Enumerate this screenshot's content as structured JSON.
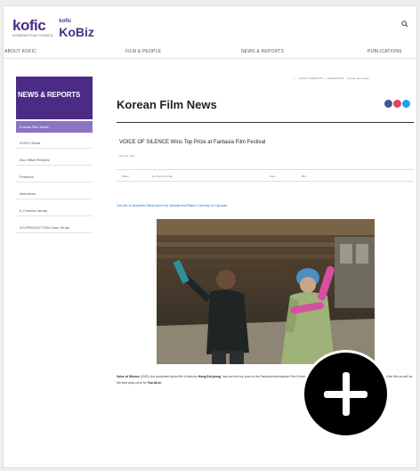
{
  "header": {
    "logo_primary": "kofic",
    "logo_primary_sub": "KOREAN FILM COUNCIL",
    "logo_secondary_small": "kofic",
    "logo_secondary": "KoBiz",
    "search_icon": "search-icon"
  },
  "nav": {
    "items": [
      "ABOUT KOFIC",
      "FILM & PEOPLE",
      "NEWS & REPORTS",
      "PUBLICATIONS"
    ]
  },
  "sidebar": {
    "heading": "NEWS & REPORTS",
    "items": [
      {
        "label": "Korean Film News",
        "active": true
      },
      {
        "label": "KOFIC News",
        "active": false
      },
      {
        "label": "Box Office Reports",
        "active": false
      },
      {
        "label": "Features",
        "active": false
      },
      {
        "label": "Interviews",
        "active": false
      },
      {
        "label": "K-Cinema Library",
        "active": false
      },
      {
        "label": "KO-PRODUCTION Case Study",
        "active": false
      }
    ]
  },
  "breadcrumb": {
    "items": [
      "⌂",
      "NEWS & REPORTS",
      "NEWSROOM",
      "Korean Film News"
    ]
  },
  "main": {
    "title": "Korean Film News",
    "share_colors": [
      "#3b5998",
      "#e4405f",
      "#1da1f2"
    ]
  },
  "article": {
    "title": "VOICE OF SILENCE Wins Top Prize at Fantasia Film Festival",
    "date": "Sep 06, 2021",
    "writer_label": "Writer",
    "writer_value": "by Pierce Conran",
    "views_label": "View",
    "views_value": "861",
    "related_link": "Yoo Ah-in Awarded Best Actor for Acclaimed Black Comedy in Canada",
    "body_intro": "Voice of Silence",
    "body_text": " (2020), the acclaimed debut film of director ",
    "body_director": "Hong Eui-jeong",
    "body_text2": ", has won the top prize at the Fantasia International Film Festival, where it picked up two awards. The Quebec festival named the film",
    "body_text3": " as well as the best actor prize for ",
    "body_actor": "Yoo Ah-in",
    "body_end": "."
  },
  "overlay": {
    "icon": "plus-icon"
  }
}
